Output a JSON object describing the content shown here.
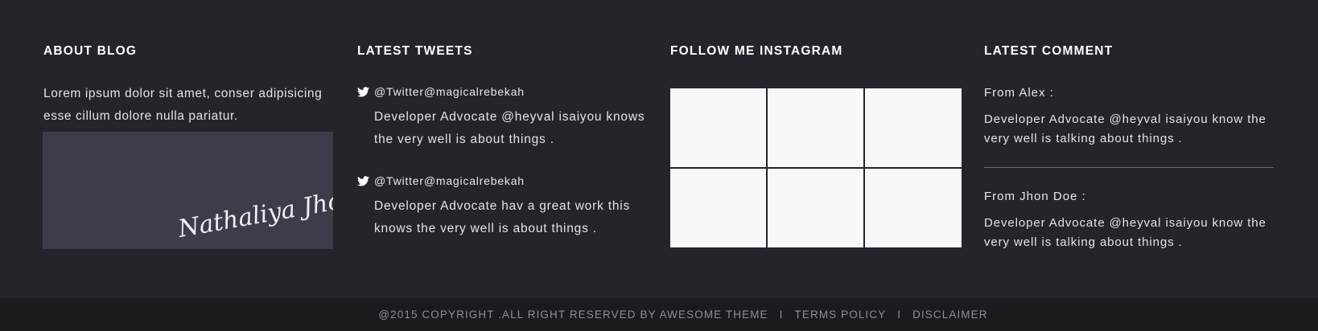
{
  "about": {
    "title": "ABOUT BLOG",
    "text": "Lorem ipsum dolor sit amet, conser adipisicing esse cillum dolore nulla pariatur.",
    "signature": "Nathaliya Jhone"
  },
  "tweets": {
    "title": "LATEST TWEETS",
    "items": [
      {
        "icon": "twitter-icon",
        "handle": "@Twitter@magicalrebekah",
        "text": "Developer Advocate @heyval isaiyou knows the very well is about things ."
      },
      {
        "icon": "twitter-icon",
        "handle": "@Twitter@magicalrebekah",
        "text": "Developer Advocate hav a great work this knows the very well is about things ."
      }
    ]
  },
  "instagram": {
    "title": "FOLLOW ME INSTAGRAM",
    "photo_count": 6
  },
  "comments": {
    "title": "LATEST COMMENT",
    "items": [
      {
        "from": "From Alex :",
        "text": "Developer Advocate @heyval isaiyou know the very well is talking about things ."
      },
      {
        "from": "From Jhon Doe :",
        "text": "Developer Advocate @heyval isaiyou know the very well is talking about things ."
      }
    ]
  },
  "bottom": {
    "copyright": "@2015 COPYRIGHT .ALL RIGHT RESERVED BY AWESOME THEME",
    "separator": "I",
    "terms": "TERMS POLICY",
    "disclaimer": "DISCLAIMER"
  },
  "colors": {
    "background": "#23252a",
    "bottom_bar": "#1a1b1f",
    "signature_box": "#3b3d4b",
    "photo_placeholder": "#f8f8fa"
  }
}
